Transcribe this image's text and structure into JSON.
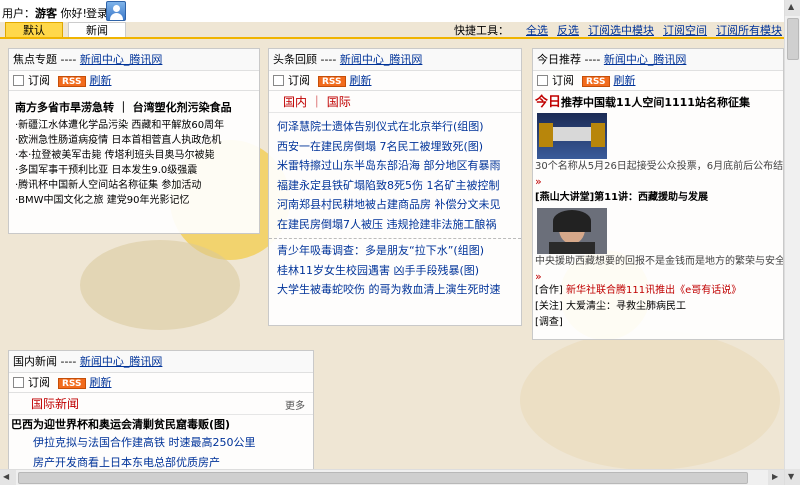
{
  "header": {
    "user_label": "用户：",
    "user_name": "游客",
    "greeting": "你好!",
    "login": "登录"
  },
  "tabs": [
    "默认",
    "新闻"
  ],
  "tools": {
    "label": "快捷工具：",
    "links": [
      "全选",
      "反选",
      "订阅选中模块",
      "订阅空间",
      "订阅所有模块"
    ]
  },
  "common": {
    "subscribe": "订阅",
    "rss": "RSS",
    "refresh": "刷新",
    "source": "新闻中心_腾讯网",
    "dashes": " ---- "
  },
  "panels": {
    "focus": {
      "title": "焦点专题",
      "lead": "南方多省市旱涝急转 ｜ 台湾塑化剂污染食品",
      "items": [
        "·新疆江水体遭化学品污染 西藏和平解放60周年",
        "·欧洲急性肠道病疫情  日本首相菅直人执政危机",
        "·本·拉登被美军击毙  传塔利班头目奥马尔被毙",
        "·多国军事干预利比亚  日本发生9.0级强震",
        "·腾讯杯中国新人空间站名称征集  参加活动",
        "·BMW中国文化之旅  建党90年光影记忆"
      ]
    },
    "headline": {
      "title": "头条回顾",
      "tab_domestic": "国内",
      "tab_sep": "｜",
      "tab_intl": "国际",
      "items": [
        "何泽慧院士遗体告别仪式在北京举行(组图)",
        "西安一在建民房倒塌  7名民工被埋致死(图)",
        "米雷特擦过山东半岛东部沿海  部分地区有暴雨",
        "福建永定县铁矿塌陷致8死5伤  1名矿主被控制",
        "河南郑县村民耕地被占建商品房  补偿分文未见",
        "在建民房倒塌7人被压  违规抢建非法施工酿祸"
      ],
      "items2": [
        "青少年吸毒调查：多是朋友“拉下水”(组图)",
        "桂林11岁女生校园遇害  凶手手段残暴(图)",
        "大学生被毒蛇咬伤  的哥为救血清上演生死时速"
      ]
    },
    "today": {
      "title": "今日推荐",
      "headline_prefix": "今日",
      "headline_rest": "推荐中国载11人空间1111站名称征集",
      "caption1": "30个名称从5月26日起接受公众投票，6月底前后公布结果。",
      "raquo": "»",
      "lecture_title": "[燕山大讲堂]第11讲：西藏援助与发展",
      "caption2": "中央援助西藏想要的回报不是金钱而是地方的繁荣与安全...",
      "coop_tag": "[合作]",
      "coop_text": "新华社联合腾111讯推出《e哥有话说》",
      "focus_tag": "[关注]",
      "focus_text": "大爱清尘：寻救尘肺病民工",
      "survey_tag": "[调查]"
    },
    "domestic": {
      "title": "国内新闻",
      "section": "国际新闻",
      "more": "更多",
      "lead": "巴西为迎世界杯和奥运会清剿贫民窟毒贩(图)",
      "items": [
        "伊拉克拟与法国合作建高铁  时速最高250公里",
        "房产开发商看上日本东电总部优质房产"
      ]
    }
  },
  "colors": {
    "accent": "#f0b400",
    "link": "#003399",
    "red": "#c00000",
    "rss": "#f26b1d"
  }
}
